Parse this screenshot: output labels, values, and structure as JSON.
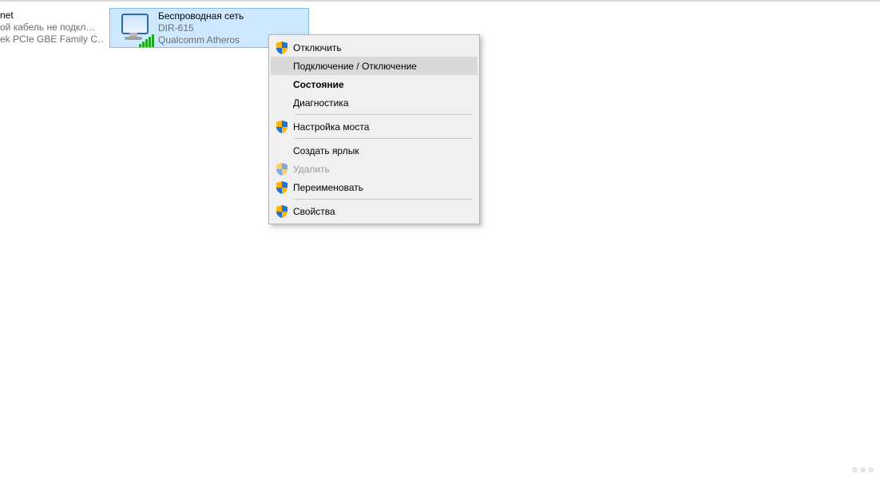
{
  "adapters": {
    "left": {
      "title_fragment": "net",
      "line2_fragment": "ой кабель не подкл…",
      "line3_fragment": "ek PCIe GBE Family C…"
    },
    "selected": {
      "title": "Беспроводная сеть",
      "ssid": "DIR-615",
      "device": "Qualcomm Atheros"
    }
  },
  "contextMenu": {
    "items": [
      {
        "label": "Отключить",
        "icon": "shield",
        "hover": false,
        "bold": false,
        "disabled": false
      },
      {
        "label": "Подключение / Отключение",
        "icon": "",
        "hover": true,
        "bold": false,
        "disabled": false
      },
      {
        "label": "Состояние",
        "icon": "",
        "hover": false,
        "bold": true,
        "disabled": false
      },
      {
        "label": "Диагностика",
        "icon": "",
        "hover": false,
        "bold": false,
        "disabled": false
      },
      {
        "label": "Настройка моста",
        "icon": "shield",
        "hover": false,
        "bold": false,
        "disabled": false
      },
      {
        "label": "Создать ярлык",
        "icon": "",
        "hover": false,
        "bold": false,
        "disabled": false
      },
      {
        "label": "Удалить",
        "icon": "shield",
        "hover": false,
        "bold": false,
        "disabled": true
      },
      {
        "label": "Переименовать",
        "icon": "shield",
        "hover": false,
        "bold": false,
        "disabled": false
      },
      {
        "label": "Свойства",
        "icon": "shield",
        "hover": false,
        "bold": false,
        "disabled": false
      }
    ]
  }
}
